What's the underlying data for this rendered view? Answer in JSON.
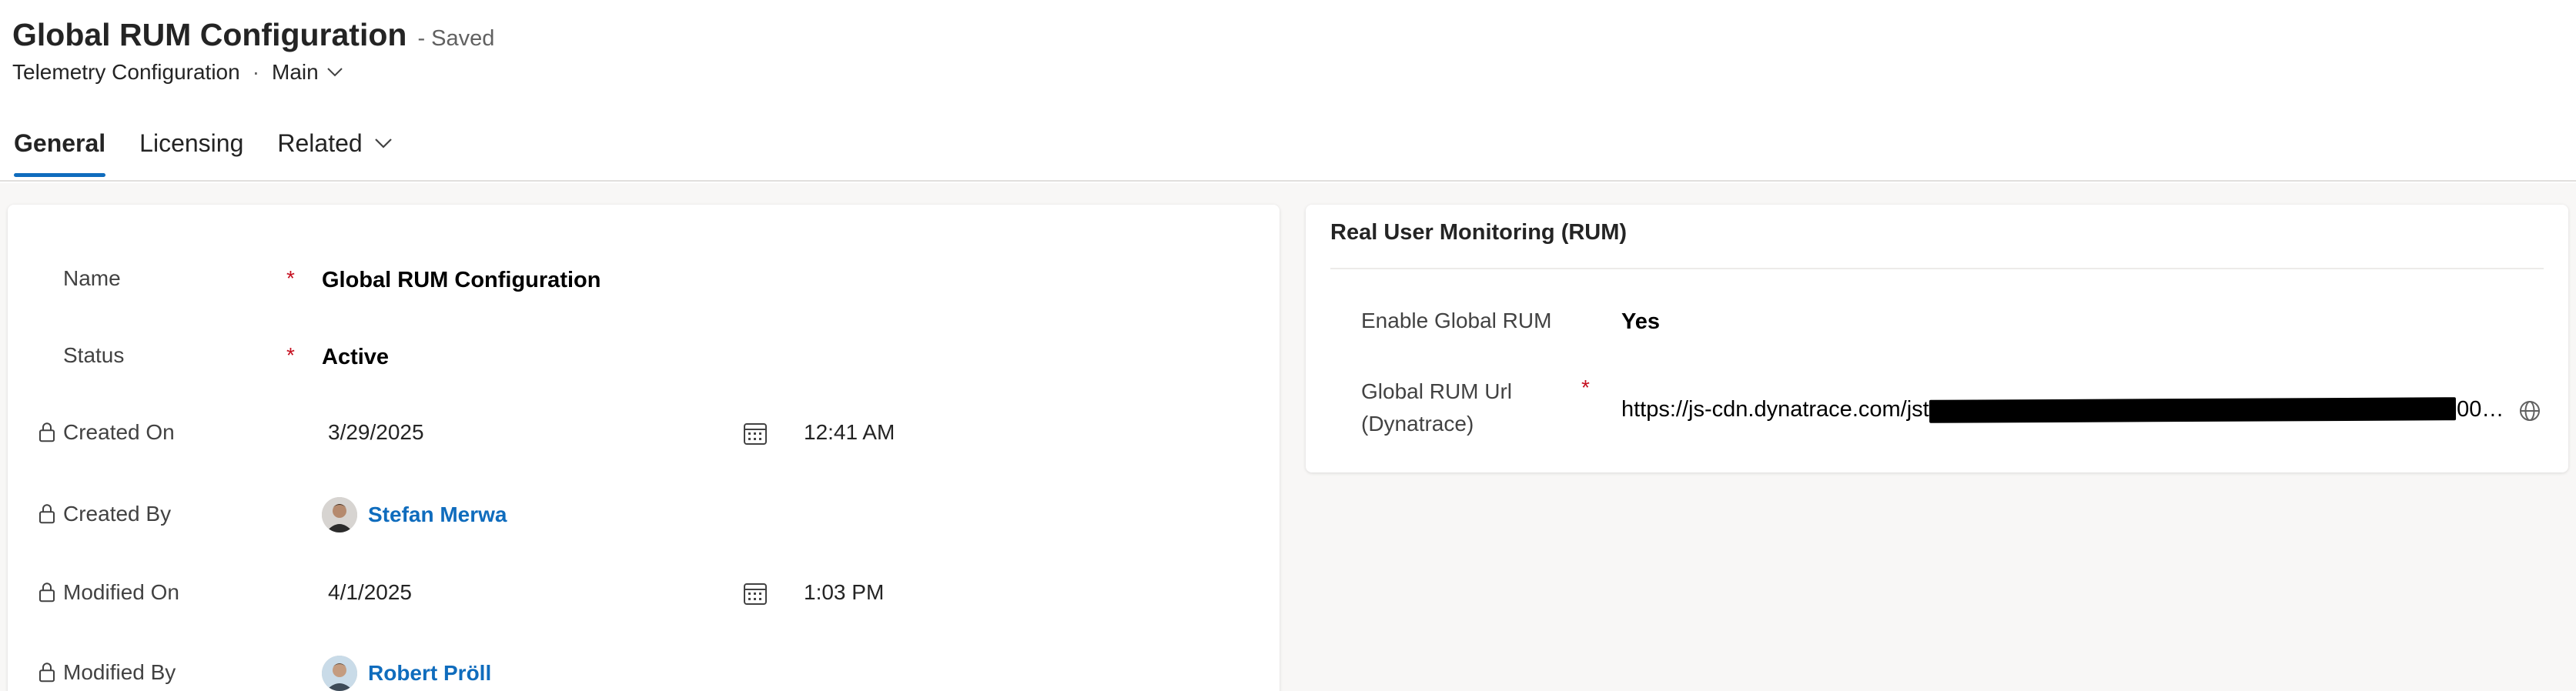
{
  "header": {
    "title": "Global RUM Configuration",
    "save_status": "- Saved",
    "entity": "Telemetry Configuration",
    "separator": "·",
    "form_name": "Main"
  },
  "tabs": [
    {
      "label": "General",
      "active": true
    },
    {
      "label": "Licensing",
      "active": false
    },
    {
      "label": "Related",
      "active": false
    }
  ],
  "general": {
    "name_label": "Name",
    "name_required": "*",
    "name_value": "Global RUM Configuration",
    "status_label": "Status",
    "status_required": "*",
    "status_value": "Active",
    "created_on_label": "Created On",
    "created_on_date": "3/29/2025",
    "created_on_time": "12:41 AM",
    "created_by_label": "Created By",
    "created_by_user": "Stefan Merwa",
    "modified_on_label": "Modified On",
    "modified_on_date": "4/1/2025",
    "modified_on_time": "1:03 PM",
    "modified_by_label": "Modified By",
    "modified_by_user": "Robert Pröll"
  },
  "rum_section": {
    "title": "Real User Monitoring (RUM)",
    "enable_label": "Enable Global RUM",
    "enable_value": "Yes",
    "url_label_line1": "Global RUM Url",
    "url_label_line2": "(Dynatrace)",
    "url_required": "*",
    "url_value": "https://js-cdn.dynatrace.com/jstag/0000000000000000000000000000000000000000000000000000000_complet..."
  },
  "colors": {
    "accent": "#0f6cbd",
    "required": "#c50f1f",
    "background": "#f8f7f6"
  },
  "icons": [
    "chevron-down-icon",
    "lock-icon",
    "calendar-icon",
    "globe-icon"
  ]
}
